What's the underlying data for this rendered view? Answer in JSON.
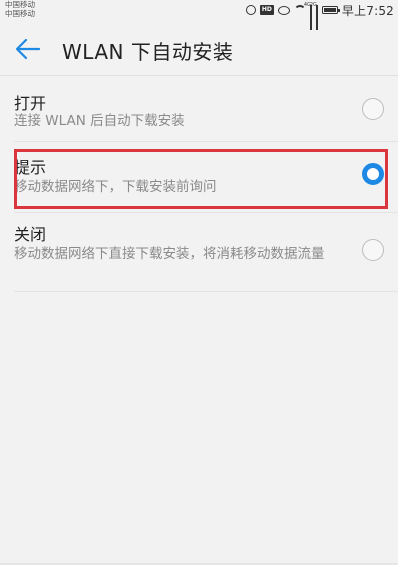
{
  "status_bar": {
    "carrier_1": "中国移动",
    "carrier_2": "中国移动",
    "hd_label": "HD",
    "sig1_tag": "4G",
    "sig2_tag": "2G",
    "time": "早上7:52"
  },
  "header": {
    "title": "WLAN 下自动安装"
  },
  "options": [
    {
      "label": "打开",
      "desc": "连接 WLAN 后自动下载安装",
      "selected": false
    },
    {
      "label": "提示",
      "desc": "移动数据网络下，下载安装前询问",
      "selected": true
    },
    {
      "label": "关闭",
      "desc": "移动数据网络下直接下载安装，将消耗移动数据流量",
      "selected": false
    }
  ],
  "colors": {
    "accent": "#1e88e5",
    "highlight": "#d9363e"
  },
  "icons": [
    "alarm-icon",
    "hd-icon",
    "eye-icon",
    "wifi-icon",
    "signal-icon",
    "battery-icon",
    "back-arrow-icon"
  ]
}
